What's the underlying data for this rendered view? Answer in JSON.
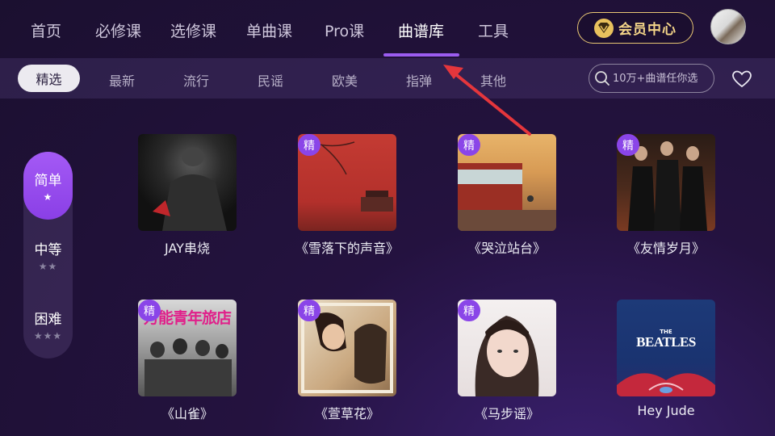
{
  "nav": {
    "tabs": [
      {
        "label": "首页"
      },
      {
        "label": "必修课"
      },
      {
        "label": "选修课"
      },
      {
        "label": "单曲课"
      },
      {
        "label": "Pro课"
      },
      {
        "label": "曲谱库"
      },
      {
        "label": "工具"
      }
    ],
    "active_tab": "曲谱库",
    "vip_label": "会员中心",
    "accent_color": "#9b5cf0"
  },
  "filters": {
    "categories": [
      "精选",
      "最新",
      "流行",
      "民谣",
      "欧美",
      "指弹",
      "其他"
    ],
    "active": "精选",
    "search_placeholder": "10万+曲谱任你选"
  },
  "difficulty": [
    {
      "name": "简单",
      "stars": "★"
    },
    {
      "name": "中等",
      "stars": "★★"
    },
    {
      "name": "困难",
      "stars": "★★★"
    }
  ],
  "songs": [
    {
      "title": "JAY串烧",
      "badge": ""
    },
    {
      "title": "《雪落下的声音》",
      "badge": "精"
    },
    {
      "title": "《哭泣站台》",
      "badge": "精"
    },
    {
      "title": "《友情岁月》",
      "badge": "精"
    },
    {
      "title": "《山雀》",
      "badge": "精"
    },
    {
      "title": "《萱草花》",
      "badge": "精"
    },
    {
      "title": "《马步谣》",
      "badge": "精"
    },
    {
      "title": "Hey Jude",
      "badge": ""
    }
  ],
  "cover_text": {
    "beatles_small": "THE",
    "beatles_big": "BEATLES",
    "shanque_banner": "万能青年旅店"
  }
}
